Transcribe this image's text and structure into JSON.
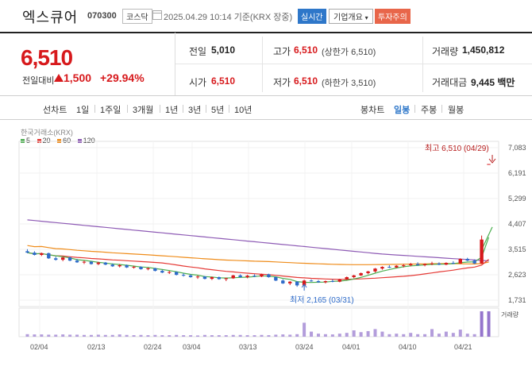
{
  "header": {
    "stock_name": "엑스큐어",
    "stock_code": "070300",
    "market": "코스닥",
    "timestamp": "2025.04.29 10:14 기준(KRX 장중)",
    "btn_realtime": "실시간",
    "btn_company": "기업개요",
    "btn_invest": "투자주의"
  },
  "price": {
    "current": "6,510",
    "change_label": "전일대비",
    "change_amount": "1,500",
    "change_percent": "+29.94%"
  },
  "quote": {
    "prev_close_label": "전일",
    "prev_close": "5,010",
    "high_label": "고가",
    "high": "6,510",
    "high_note": "(상한가 6,510)",
    "volume_label": "거래량",
    "volume": "1,450,812",
    "open_label": "시가",
    "open": "6,510",
    "low_label": "저가",
    "low": "6,510",
    "low_note": "(하한가 3,510)",
    "amount_label": "거래대금",
    "amount": "9,445 백만"
  },
  "period_bar": {
    "line_chart": "선차트",
    "periods": [
      "1일",
      "1주일",
      "3개월",
      "1년",
      "3년",
      "5년",
      "10년"
    ],
    "candle_chart": "봉차트",
    "candle_periods": [
      "일봉",
      "주봉",
      "월봉"
    ],
    "active_candle": "일봉"
  },
  "chart_data": {
    "type": "candlestick",
    "source_label": "한국거래소(KRX)",
    "legend": [
      {
        "name": "5",
        "color": "#4caf50"
      },
      {
        "name": "20",
        "color": "#e53935"
      },
      {
        "name": "60",
        "color": "#ef8c1a"
      },
      {
        "name": "120",
        "color": "#8e5bb5"
      }
    ],
    "y_ticks": [
      "7,083",
      "6,191",
      "5,299",
      "4,407",
      "3,515",
      "2,623",
      "1,731"
    ],
    "y_tick_values": [
      7083,
      6191,
      5299,
      4407,
      3515,
      2623,
      1731
    ],
    "x_ticks": [
      "02/04",
      "02/13",
      "02/24",
      "03/04",
      "03/13",
      "03/24",
      "04/01",
      "04/10",
      "04/21"
    ],
    "max_label": "최고 6,510 (04/29)",
    "min_label": "최저 2,165 (03/31)",
    "volume_label": "거래량",
    "up_color": "#d7191c",
    "down_color": "#2e6bc9",
    "candles": [
      [
        3450,
        3520,
        3380,
        3400
      ],
      [
        3400,
        3450,
        3300,
        3320
      ],
      [
        3320,
        3400,
        3280,
        3380
      ],
      [
        3380,
        3400,
        3180,
        3200
      ],
      [
        3200,
        3260,
        3120,
        3150
      ],
      [
        3150,
        3250,
        3100,
        3230
      ],
      [
        3230,
        3260,
        3100,
        3120
      ],
      [
        3120,
        3180,
        3040,
        3060
      ],
      [
        3060,
        3120,
        3000,
        3080
      ],
      [
        3080,
        3100,
        2980,
        3000
      ],
      [
        3000,
        3080,
        2960,
        3050
      ],
      [
        3050,
        3070,
        2960,
        2980
      ],
      [
        2980,
        3020,
        2900,
        2920
      ],
      [
        2920,
        3000,
        2880,
        2960
      ],
      [
        2960,
        2980,
        2860,
        2880
      ],
      [
        2880,
        2940,
        2840,
        2900
      ],
      [
        2900,
        2920,
        2800,
        2820
      ],
      [
        2820,
        2880,
        2780,
        2850
      ],
      [
        2850,
        2870,
        2740,
        2760
      ],
      [
        2760,
        2800,
        2680,
        2700
      ],
      [
        2700,
        2760,
        2650,
        2720
      ],
      [
        2720,
        2740,
        2600,
        2620
      ],
      [
        2620,
        2680,
        2560,
        2600
      ],
      [
        2600,
        2640,
        2520,
        2540
      ],
      [
        2540,
        2600,
        2480,
        2560
      ],
      [
        2560,
        2580,
        2460,
        2480
      ],
      [
        2480,
        2560,
        2440,
        2540
      ],
      [
        2540,
        2560,
        2450,
        2470
      ],
      [
        2470,
        2520,
        2400,
        2500
      ],
      [
        2500,
        2620,
        2480,
        2600
      ],
      [
        2600,
        2640,
        2520,
        2540
      ],
      [
        2540,
        2620,
        2500,
        2590
      ],
      [
        2590,
        2640,
        2540,
        2560
      ],
      [
        2560,
        2660,
        2540,
        2640
      ],
      [
        2640,
        2660,
        2520,
        2540
      ],
      [
        2540,
        2560,
        2400,
        2420
      ],
      [
        2420,
        2460,
        2300,
        2320
      ],
      [
        2320,
        2400,
        2260,
        2380
      ],
      [
        2380,
        2400,
        2200,
        2250
      ],
      [
        2250,
        2450,
        2165,
        2420
      ],
      [
        2420,
        2460,
        2380,
        2400
      ],
      [
        2400,
        2440,
        2340,
        2360
      ],
      [
        2360,
        2420,
        2320,
        2400
      ],
      [
        2400,
        2460,
        2360,
        2380
      ],
      [
        2380,
        2480,
        2360,
        2460
      ],
      [
        2460,
        2560,
        2440,
        2540
      ],
      [
        2540,
        2620,
        2500,
        2600
      ],
      [
        2600,
        2700,
        2580,
        2680
      ],
      [
        2680,
        2760,
        2640,
        2740
      ],
      [
        2740,
        2860,
        2700,
        2840
      ],
      [
        2840,
        2920,
        2800,
        2900
      ],
      [
        2900,
        2960,
        2860,
        2880
      ],
      [
        2880,
        2960,
        2860,
        2940
      ],
      [
        2940,
        3000,
        2880,
        2960
      ],
      [
        2960,
        3040,
        2920,
        3000
      ],
      [
        3000,
        3060,
        2940,
        2960
      ],
      [
        2960,
        3020,
        2920,
        3000
      ],
      [
        3000,
        3080,
        2960,
        3020
      ],
      [
        3020,
        3060,
        2960,
        2980
      ],
      [
        2980,
        3060,
        2960,
        3040
      ],
      [
        3040,
        3100,
        3000,
        3020
      ],
      [
        3020,
        3200,
        3000,
        3180
      ],
      [
        3180,
        3220,
        3100,
        3120
      ],
      [
        3120,
        3160,
        3000,
        3020
      ],
      [
        3020,
        4000,
        3000,
        3860
      ],
      [
        6510,
        6510,
        6510,
        6510
      ]
    ],
    "volumes": [
      0.1,
      0.09,
      0.09,
      0.08,
      0.08,
      0.09,
      0.08,
      0.08,
      0.07,
      0.07,
      0.08,
      0.07,
      0.07,
      0.09,
      0.07,
      0.06,
      0.07,
      0.06,
      0.07,
      0.06,
      0.06,
      0.07,
      0.06,
      0.06,
      0.05,
      0.07,
      0.06,
      0.06,
      0.06,
      0.07,
      0.07,
      0.06,
      0.06,
      0.07,
      0.06,
      0.08,
      0.09,
      0.08,
      0.1,
      0.55,
      0.2,
      0.12,
      0.1,
      0.09,
      0.12,
      0.15,
      0.25,
      0.18,
      0.22,
      0.3,
      0.2,
      0.1,
      0.12,
      0.1,
      0.15,
      0.1,
      0.1,
      0.3,
      0.12,
      0.2,
      0.15,
      0.28,
      0.12,
      0.1,
      1.0,
      1.0
    ]
  }
}
